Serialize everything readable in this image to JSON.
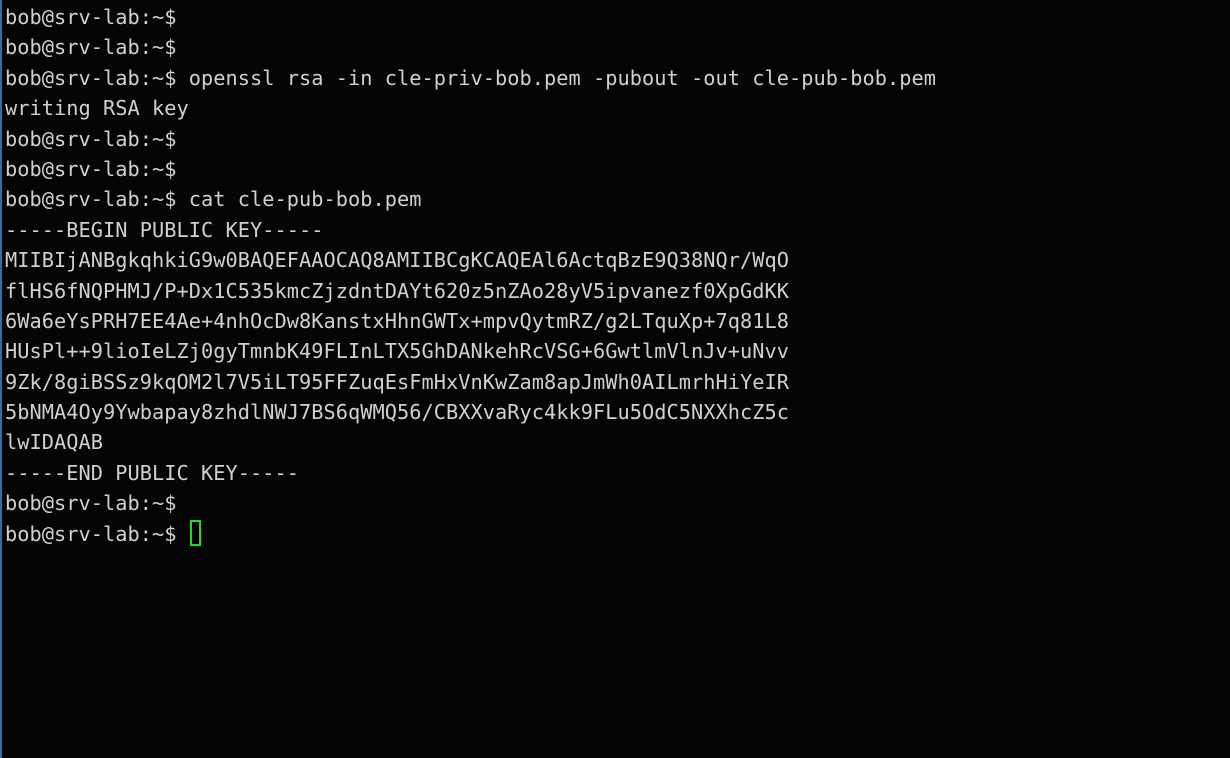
{
  "terminal": {
    "prompt": "bob@srv-lab:~$ ",
    "lines": [
      "bob@srv-lab:~$",
      "bob@srv-lab:~$",
      "bob@srv-lab:~$ openssl rsa -in cle-priv-bob.pem -pubout -out cle-pub-bob.pem",
      "writing RSA key",
      "bob@srv-lab:~$",
      "bob@srv-lab:~$",
      "bob@srv-lab:~$ cat cle-pub-bob.pem",
      "-----BEGIN PUBLIC KEY-----",
      "MIIBIjANBgkqhkiG9w0BAQEFAAOCAQ8AMIIBCgKCAQEAl6ActqBzE9Q38NQr/WqO",
      "flHS6fNQPHMJ/P+Dx1C535kmcZjzdntDAYt620z5nZAo28yV5ipvanezf0XpGdKK",
      "6Wa6eYsPRH7EE4Ae+4nhOcDw8KanstxHhnGWTx+mpvQytmRZ/g2LTquXp+7q81L8",
      "HUsPl++9lioIeLZj0gyTmnbK49FLInLTX5GhDANkehRcVSG+6GwtlmVlnJv+uNvv",
      "9Zk/8giBSSz9kqOM2l7V5iLT95FFZuqEsFmHxVnKwZam8apJmWh0AILmrhHiYeIR",
      "5bNMA4Oy9Ywbapay8zhdlNWJ7BS6qWMQ56/CBXXvaRyc4kk9FLu5OdC5NXXhcZ5c",
      "lwIDAQAB",
      "-----END PUBLIC KEY-----",
      "bob@srv-lab:~$"
    ]
  },
  "colors": {
    "background": "#050505",
    "text": "#d0d0d0",
    "cursor": "#22dd22",
    "window_edge": "#2a6fb0"
  }
}
